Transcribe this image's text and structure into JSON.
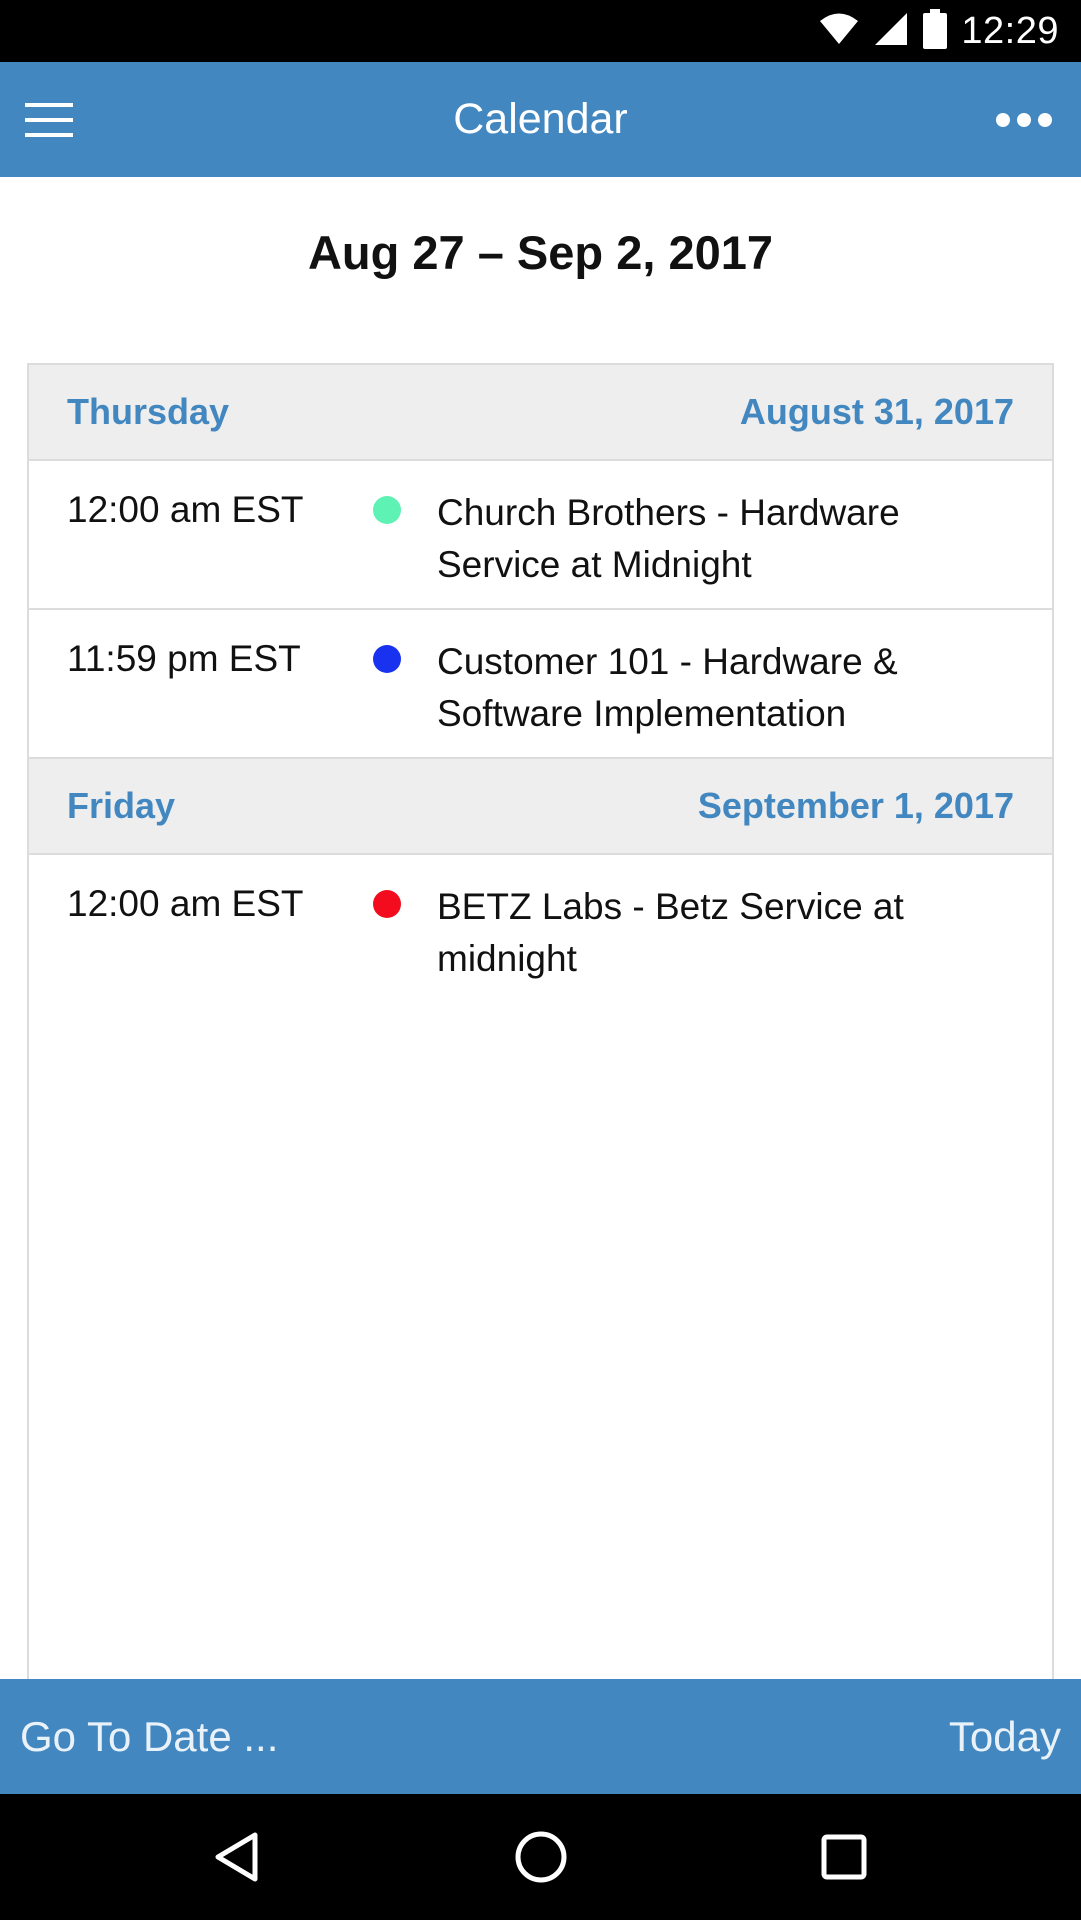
{
  "status_bar": {
    "time": "12:29"
  },
  "app_bar": {
    "title": "Calendar"
  },
  "week_range": "Aug 27 – Sep 2, 2017",
  "days": [
    {
      "weekday": "Thursday",
      "date": "August 31, 2017",
      "events": [
        {
          "time": "12:00 am EST",
          "title": "Church Brothers - Hardware Service at Midnight",
          "color": "#5ef2b4"
        },
        {
          "time": "11:59 pm EST",
          "title": "Customer 101 - Hardware & Software Implementation",
          "color": "#1832f0"
        }
      ]
    },
    {
      "weekday": "Friday",
      "date": "September 1, 2017",
      "events": [
        {
          "time": "12:00 am EST",
          "title": "BETZ Labs - Betz Service at midnight",
          "color": "#f20c1e"
        }
      ]
    }
  ],
  "bottom_bar": {
    "goto_label": "Go To Date ...",
    "today_label": "Today"
  },
  "colors": {
    "accent": "#4287c0",
    "header_bg": "#eeeeee"
  }
}
